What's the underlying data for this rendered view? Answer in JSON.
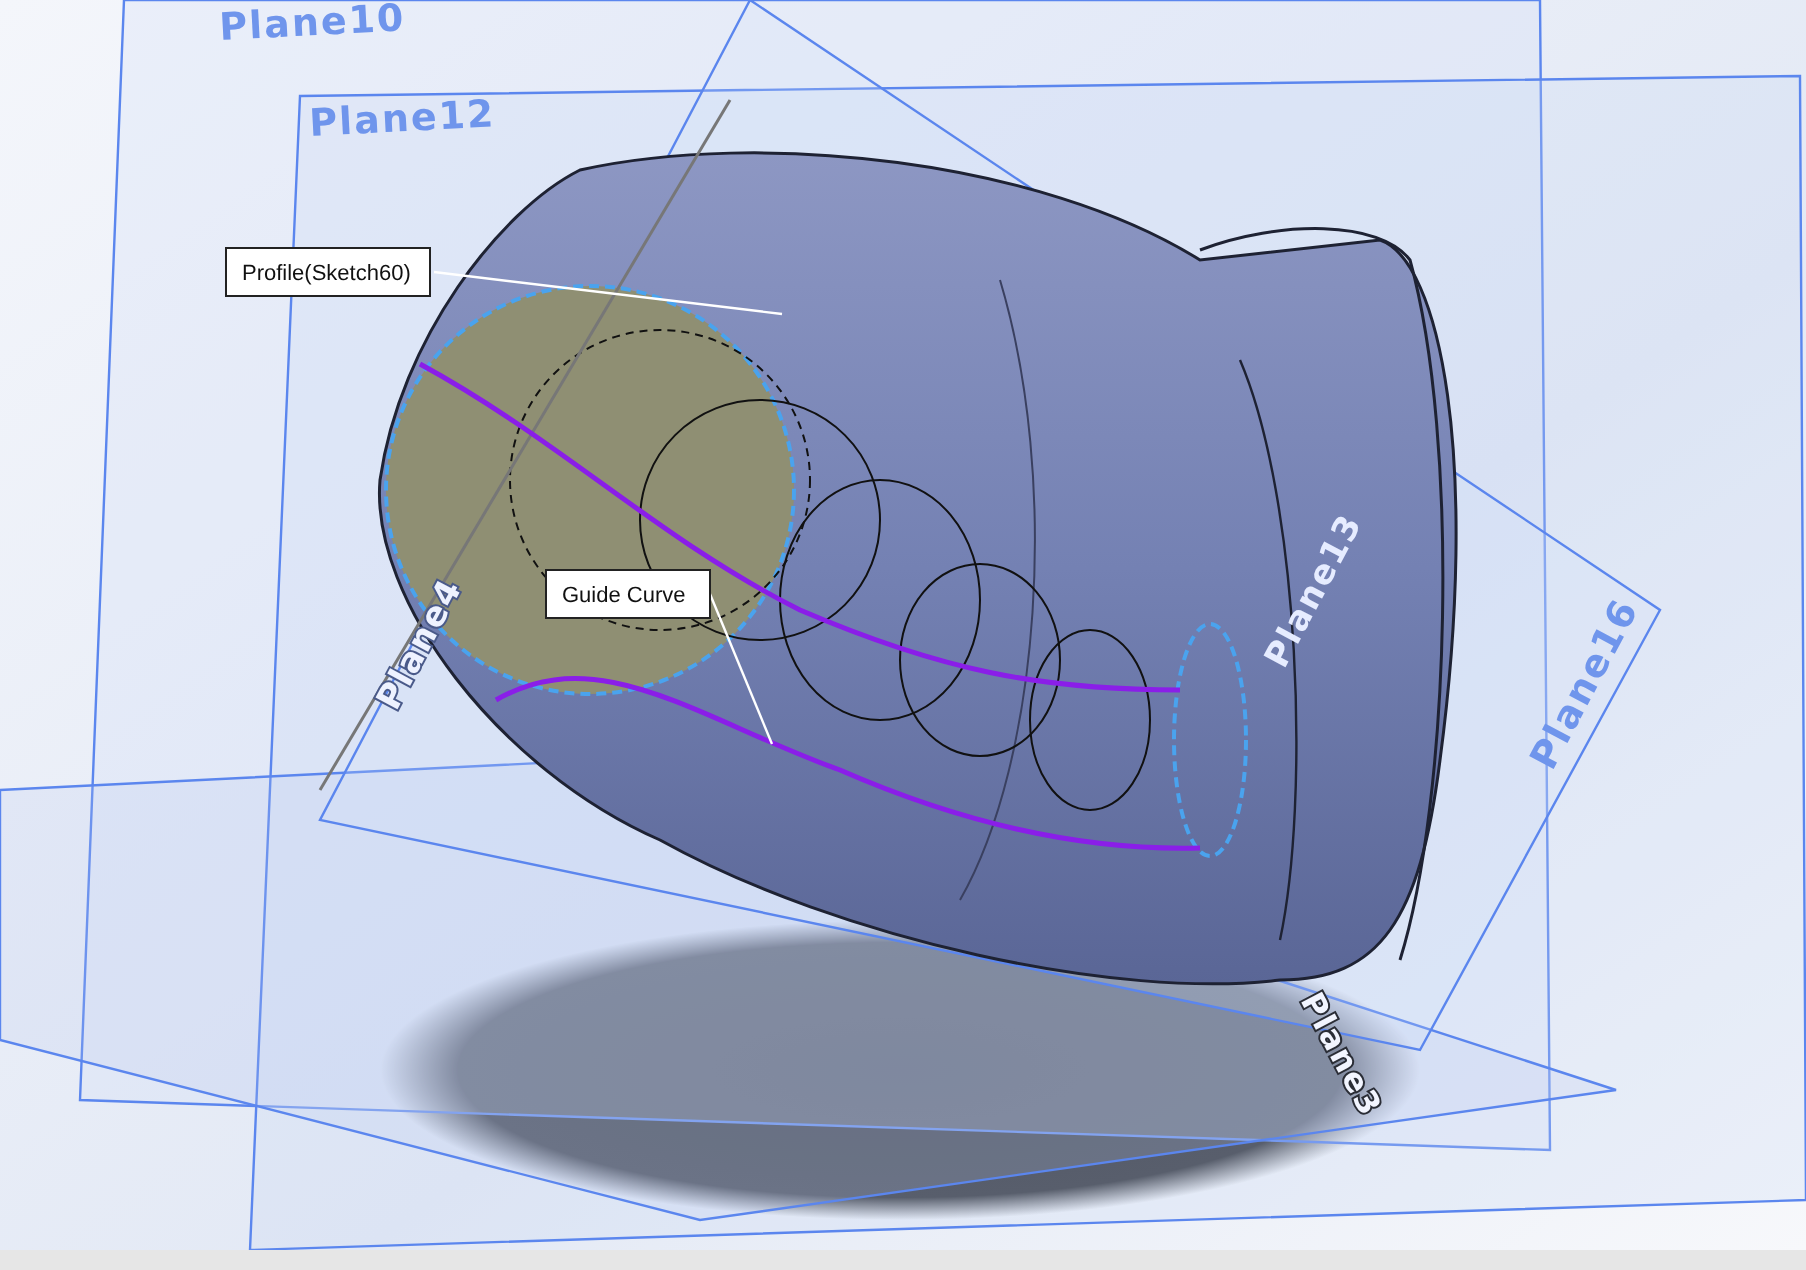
{
  "viewport": {
    "plane_labels": [
      {
        "text": "Plane10"
      },
      {
        "text": "Plane12"
      },
      {
        "text": "Plane4"
      },
      {
        "text": "Plane13"
      },
      {
        "text": "Plane16"
      },
      {
        "text": "Plane3"
      }
    ],
    "callouts": [
      {
        "text": "Profile(Sketch60)"
      },
      {
        "text": "Guide Curve"
      }
    ]
  }
}
